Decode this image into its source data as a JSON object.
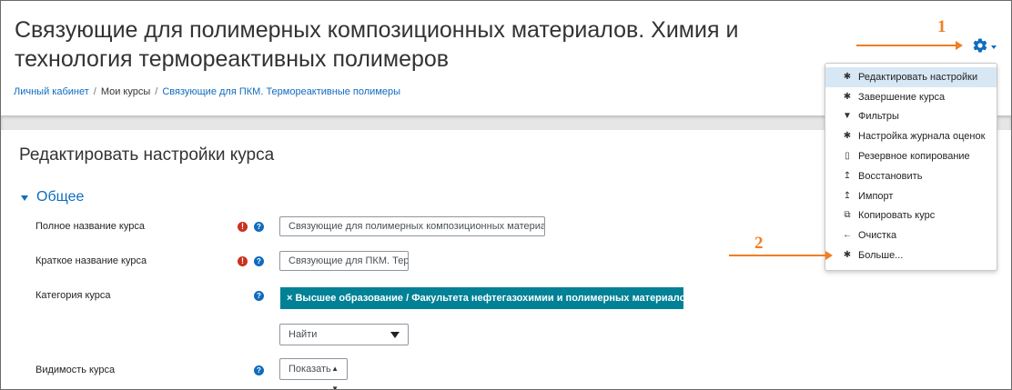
{
  "page": {
    "title": "Связующие для полимерных композиционных материалов. Химия и технология термореактивных полимеров"
  },
  "breadcrumb": [
    {
      "label": "Личный кабинет",
      "link": true
    },
    {
      "label": "Мои курсы",
      "link": false
    },
    {
      "label": "Связующие для ПКМ. Термореактивные полимеры",
      "link": true
    }
  ],
  "annotations": {
    "one": "1",
    "two": "2"
  },
  "menu": {
    "items": [
      {
        "label": "Редактировать настройки",
        "icon": "gear-icon",
        "active": true
      },
      {
        "label": "Завершение курса",
        "icon": "gear-icon"
      },
      {
        "label": "Фильтры",
        "icon": "filter-icon"
      },
      {
        "label": "Настройка журнала оценок",
        "icon": "gear-icon"
      },
      {
        "label": "Резервное копирование",
        "icon": "file-icon"
      },
      {
        "label": "Восстановить",
        "icon": "upload-icon"
      },
      {
        "label": "Импорт",
        "icon": "import-icon"
      },
      {
        "label": "Копировать курс",
        "icon": "copy-icon"
      },
      {
        "label": "Очистка",
        "icon": "arrow-left-icon"
      },
      {
        "label": "Больше...",
        "icon": "gear-icon"
      }
    ]
  },
  "form": {
    "heading": "Редактировать настройки курса",
    "section": "Общее",
    "fullname": {
      "label": "Полное название курса",
      "value": "Связующие для полимерных композиционных материа"
    },
    "shortname": {
      "label": "Краткое название курса",
      "value": "Связующие для ПКМ. Тер"
    },
    "category": {
      "label": "Категория курса",
      "tag": "× Высшее образование / Факультета нефтегазохимии и полимерных материалов",
      "search": "Найти"
    },
    "visibility": {
      "label": "Видимость курса",
      "value": "Показать"
    }
  },
  "colors": {
    "accent": "#0f6cbf",
    "annotation": "#f07e24",
    "required": "#ca3120",
    "tag": "#008196"
  }
}
